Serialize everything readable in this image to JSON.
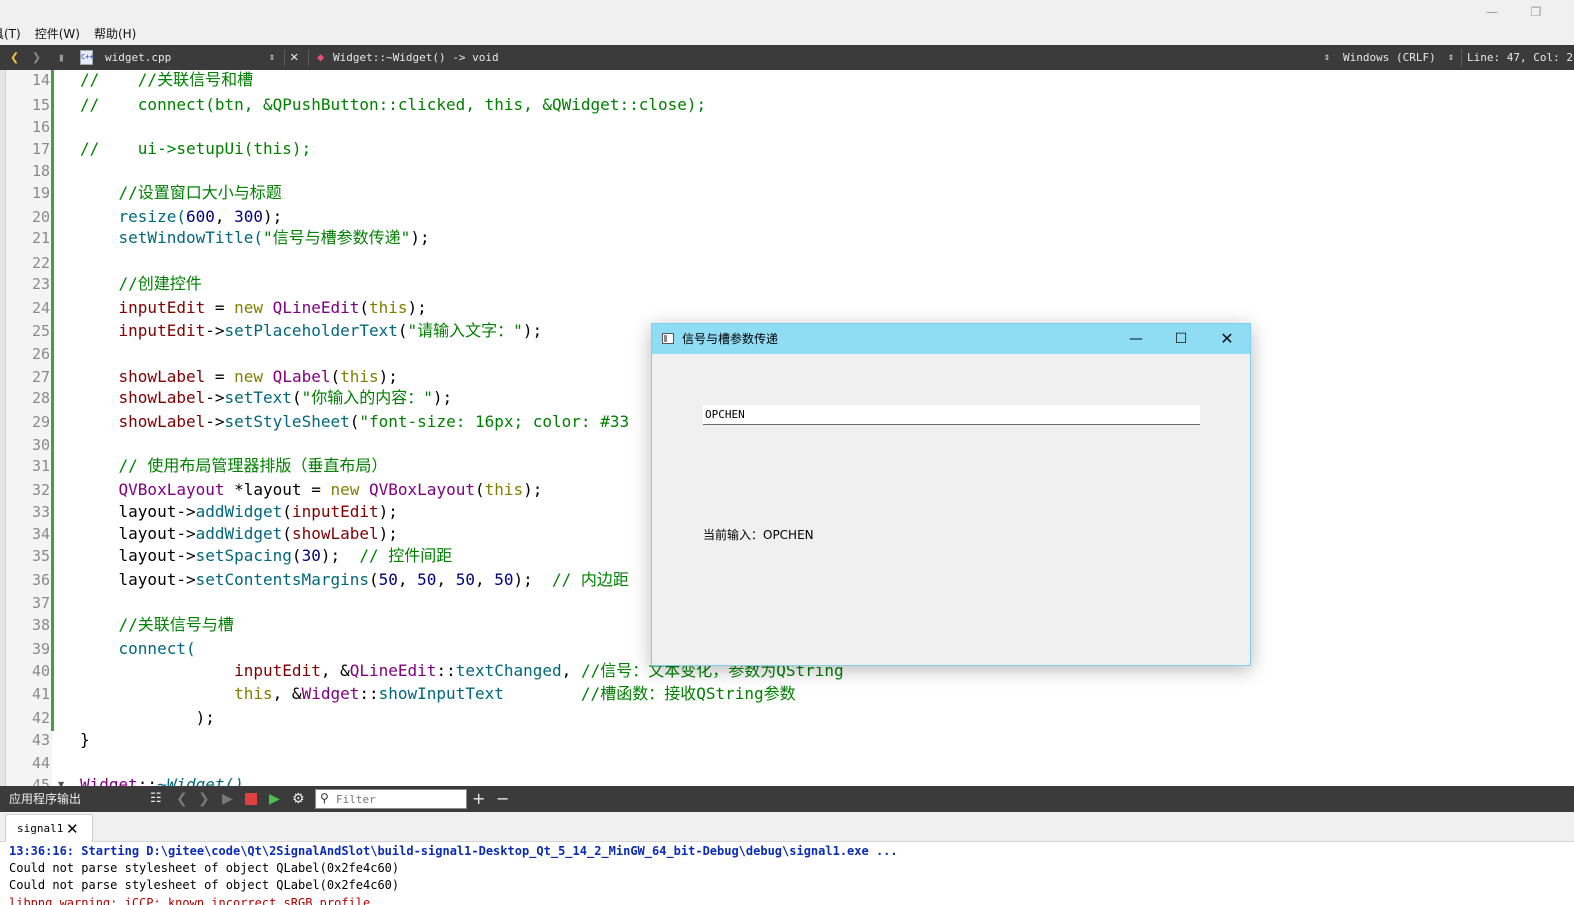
{
  "menubar": {
    "items": [
      "具(T)",
      "控件(W)",
      "帮助(H)"
    ]
  },
  "editor_toolbar": {
    "file_name": "widget.cpp",
    "function_sig": "Widget::~Widget() -> void",
    "line_ending": "Windows (CRLF)",
    "cursor_pos": "Line: 47, Col: 2"
  },
  "editor": {
    "line_numbers": [
      "14",
      "15",
      "16",
      "17",
      "18",
      "19",
      "20",
      "21",
      "22",
      "23",
      "24",
      "25",
      "26",
      "27",
      "28",
      "29",
      "30",
      "31",
      "32",
      "33",
      "34",
      "35",
      "36",
      "37",
      "38",
      "39",
      "40",
      "41",
      "42",
      "43",
      "44",
      "45"
    ],
    "code": {
      "l14": "//    //关联信号和槽",
      "l15": "//    connect(btn, &QPushButton::clicked, this, &QWidget::close);",
      "l17": "//    ui->setupUi(this);",
      "l19": "    //设置窗口大小与标题",
      "l20a": "    resize(",
      "l20b": "600",
      "l20c": ", ",
      "l20d": "300",
      "l20e": ");",
      "l21a": "    setWindowTitle(",
      "l21b": "\"信号与槽参数传递\"",
      "l21c": ");",
      "l23": "    //创建控件",
      "l24a": "    inputEdit",
      "l24b": " = ",
      "l24c": "new",
      "l24d": " QLineEdit",
      "l24e": "(",
      "l24f": "this",
      "l24g": ");",
      "l25a": "    inputEdit",
      "l25b": "->",
      "l25c": "setPlaceholderText",
      "l25d": "(",
      "l25e": "\"请输入文字：\"",
      "l25f": ");",
      "l27a": "    showLabel",
      "l27b": " = ",
      "l27c": "new",
      "l27d": " QLabel",
      "l27e": "(",
      "l27f": "this",
      "l27g": ");",
      "l28a": "    showLabel",
      "l28b": "->",
      "l28c": "setText",
      "l28d": "(",
      "l28e": "\"你输入的内容：\"",
      "l28f": ");",
      "l29a": "    showLabel",
      "l29b": "->",
      "l29c": "setStyleSheet",
      "l29d": "(",
      "l29e": "\"font-size: 16px; color: #33",
      "l31": "    // 使用布局管理器排版（垂直布局）",
      "l32a": "    QVBoxLayout",
      "l32b": " *",
      "l32c": "layout",
      "l32d": " = ",
      "l32e": "new",
      "l32f": " QVBoxLayout",
      "l32g": "(",
      "l32h": "this",
      "l32i": ");",
      "l33a": "    layout",
      "l33b": "->",
      "l33c": "addWidget",
      "l33d": "(",
      "l33e": "inputEdit",
      "l33f": ");",
      "l34a": "    layout",
      "l34b": "->",
      "l34c": "addWidget",
      "l34d": "(",
      "l34e": "showLabel",
      "l34f": ");",
      "l35a": "    layout",
      "l35b": "->",
      "l35c": "setSpacing",
      "l35d": "(",
      "l35e": "30",
      "l35f": ");  ",
      "l35g": "// 控件间距",
      "l36a": "    layout",
      "l36b": "->",
      "l36c": "setContentsMargins",
      "l36d": "(",
      "l36e": "50",
      "l36f": ", ",
      "l36g": "50",
      "l36h": ", ",
      "l36i": "50",
      "l36j": ", ",
      "l36k": "50",
      "l36l": ");  ",
      "l36m": "// 内边距",
      "l38": "    //关联信号与槽",
      "l39": "    connect(",
      "l40a": "                inputEdit",
      "l40b": ", &",
      "l40c": "QLineEdit",
      "l40d": "::",
      "l40e": "textChanged",
      "l40f": ", ",
      "l40g": "//信号：文本变化，参数为QString",
      "l41a": "                this",
      "l41b": ", &",
      "l41c": "Widget",
      "l41d": "::",
      "l41e": "showInputText",
      "l41f": "        ",
      "l41g": "//槽函数：接收QString参数",
      "l42": "            );",
      "l43": "}",
      "l45a": "Widget",
      "l45b": "::",
      "l45c": "~Widget()"
    }
  },
  "dialog": {
    "title": "信号与槽参数传递",
    "input_value": "OPCHEN",
    "label_text": "当前输入：OPCHEN"
  },
  "output_pane": {
    "title": "应用程序输出",
    "filter_placeholder": "Filter",
    "tab_label": "signal1",
    "lines": [
      "13:36:16: Starting D:\\gitee\\code\\Qt\\2SignalAndSlot\\build-signal1-Desktop_Qt_5_14_2_MinGW_64_bit-Debug\\debug\\signal1.exe ...",
      "Could not parse stylesheet of object QLabel(0x2fe4c60)",
      "Could not parse stylesheet of object QLabel(0x2fe4c60)",
      "libpng warning: iCCP: known incorrect sRGB profile"
    ]
  },
  "colors": {
    "comment": "#008000",
    "keyword": "#808000",
    "function": "#00677c",
    "type": "#800080",
    "number": "#000080",
    "member": "#800000",
    "dialog_title_bg": "#8fdcf5",
    "toolbar_bg": "#3b3b3b",
    "change_bar": "#3da33d"
  },
  "icons": [
    "back-arrow-icon",
    "forward-arrow-icon",
    "lock-icon",
    "cpp-file-icon",
    "close-icon",
    "function-icon",
    "minimize-icon",
    "maximize-icon",
    "window-close-icon",
    "window-app-icon",
    "clear-icon",
    "prev-icon",
    "next-icon",
    "run-icon",
    "stop-icon",
    "rerun-icon",
    "settings-icon",
    "search-icon",
    "add-icon",
    "remove-icon",
    "tab-close-icon"
  ]
}
